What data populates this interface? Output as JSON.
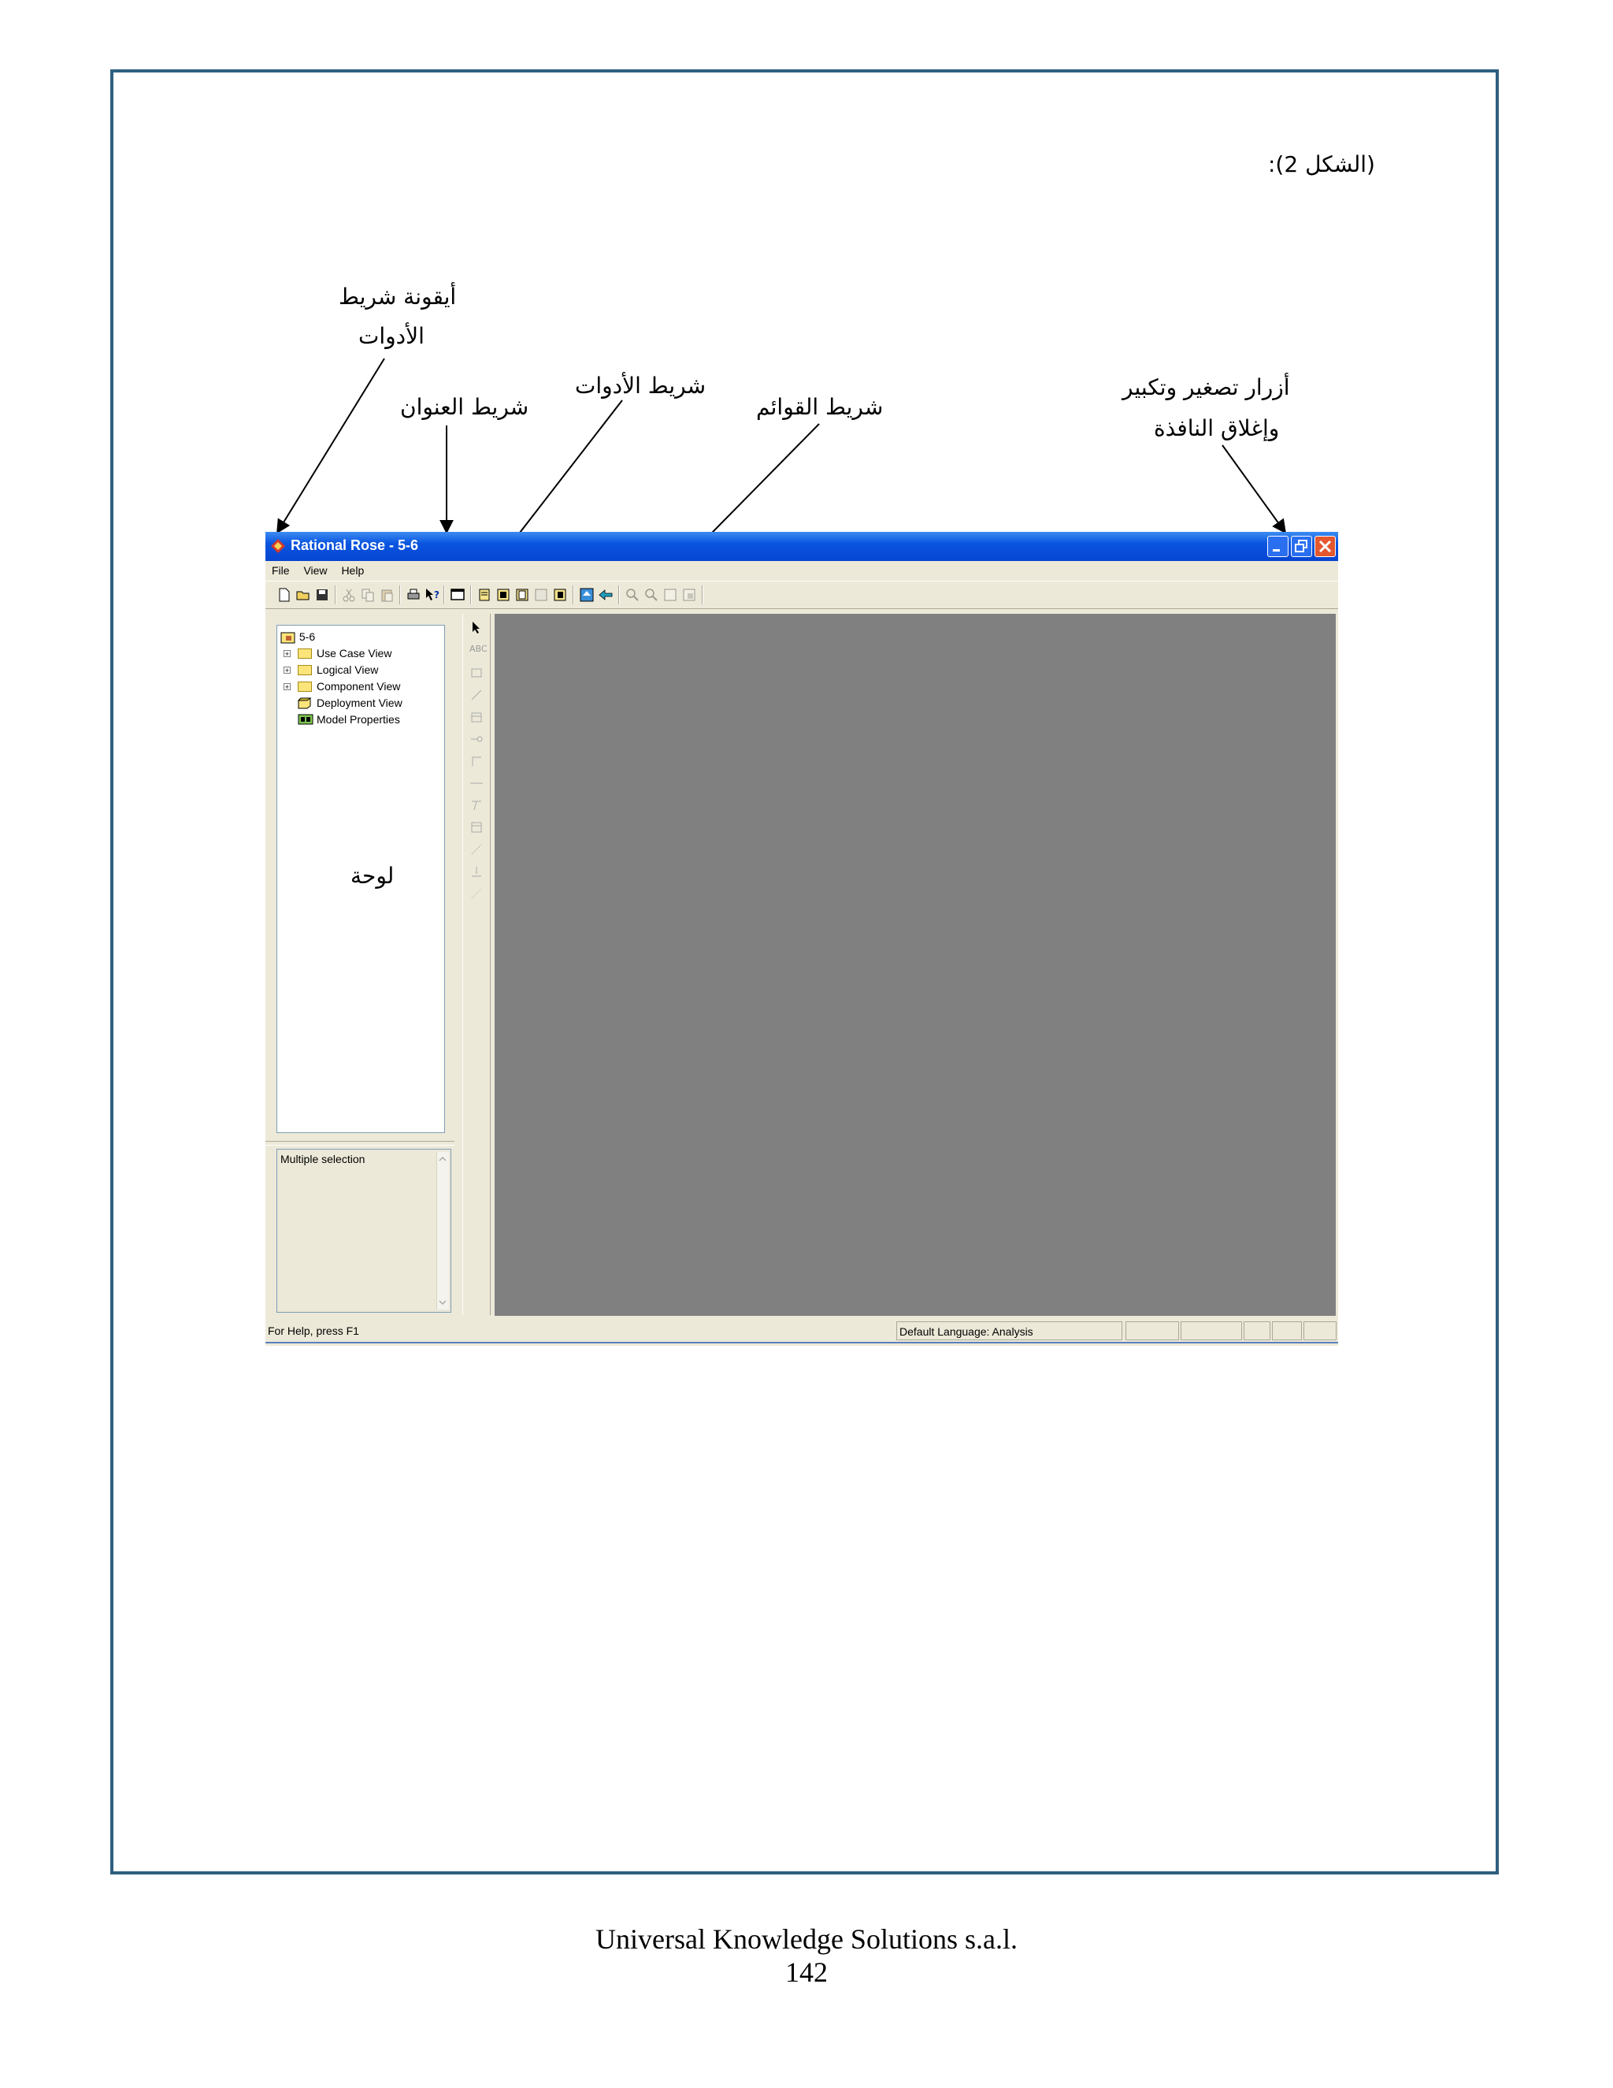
{
  "figure_label": "(الشكل 2):",
  "annotations": {
    "toolbar_icon_line1": "أيقونة شريط",
    "toolbar_icon_line2": "الأدوات",
    "title_bar": "شريط العنوان",
    "toolbar": "شريط الأدوات",
    "menu_bar": "شريط القوائم",
    "window_buttons_line1": "أزرار تصغير وتكبير",
    "window_buttons_line2": "وإغلاق النافذة",
    "panel": "لوحة"
  },
  "window": {
    "title": "Rational Rose - 5-6",
    "menus": [
      "File",
      "View",
      "Help"
    ],
    "tree": {
      "root": "5-6",
      "items": [
        "Use Case View",
        "Logical View",
        "Component View",
        "Deployment View",
        "Model Properties"
      ]
    },
    "documentation": "Multiple selection",
    "status": {
      "help": "For Help, press F1",
      "language": "Default Language: Analysis"
    },
    "vertical_tools": [
      "ABC"
    ]
  },
  "footer": {
    "company": "Universal Knowledge Solutions s.a.l.",
    "page": "142"
  }
}
